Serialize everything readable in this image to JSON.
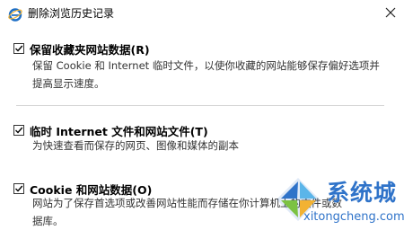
{
  "window": {
    "title": "删除浏览历史记录"
  },
  "options": [
    {
      "label": "保留收藏夹网站数据(R)",
      "checked": true,
      "description": [
        "保留 Cookie 和 Internet 临时文件，以使你收藏的网站能够保存偏好选项并",
        "提高显示速度。"
      ]
    },
    {
      "label": "临时 Internet 文件和网站文件(T)",
      "checked": true,
      "description": [
        "为快速查看而保存的网页、图像和媒体的副本"
      ]
    },
    {
      "label": "Cookie 和网站数据(O)",
      "checked": true,
      "description": [
        "网站为了保存首选项或改善网站性能而存储在你计算机上的文件或数",
        "据库。"
      ]
    }
  ],
  "watermark": {
    "brand": "系统城",
    "url": "xitongcheng.com"
  },
  "colors": {
    "accent": "#2f73c9",
    "ie_blue": "#1e6fc6"
  },
  "icons": {
    "app": "ie-icon",
    "close": "close-icon",
    "check": "checkmark-icon",
    "watermark": "windows-logo-icon"
  }
}
